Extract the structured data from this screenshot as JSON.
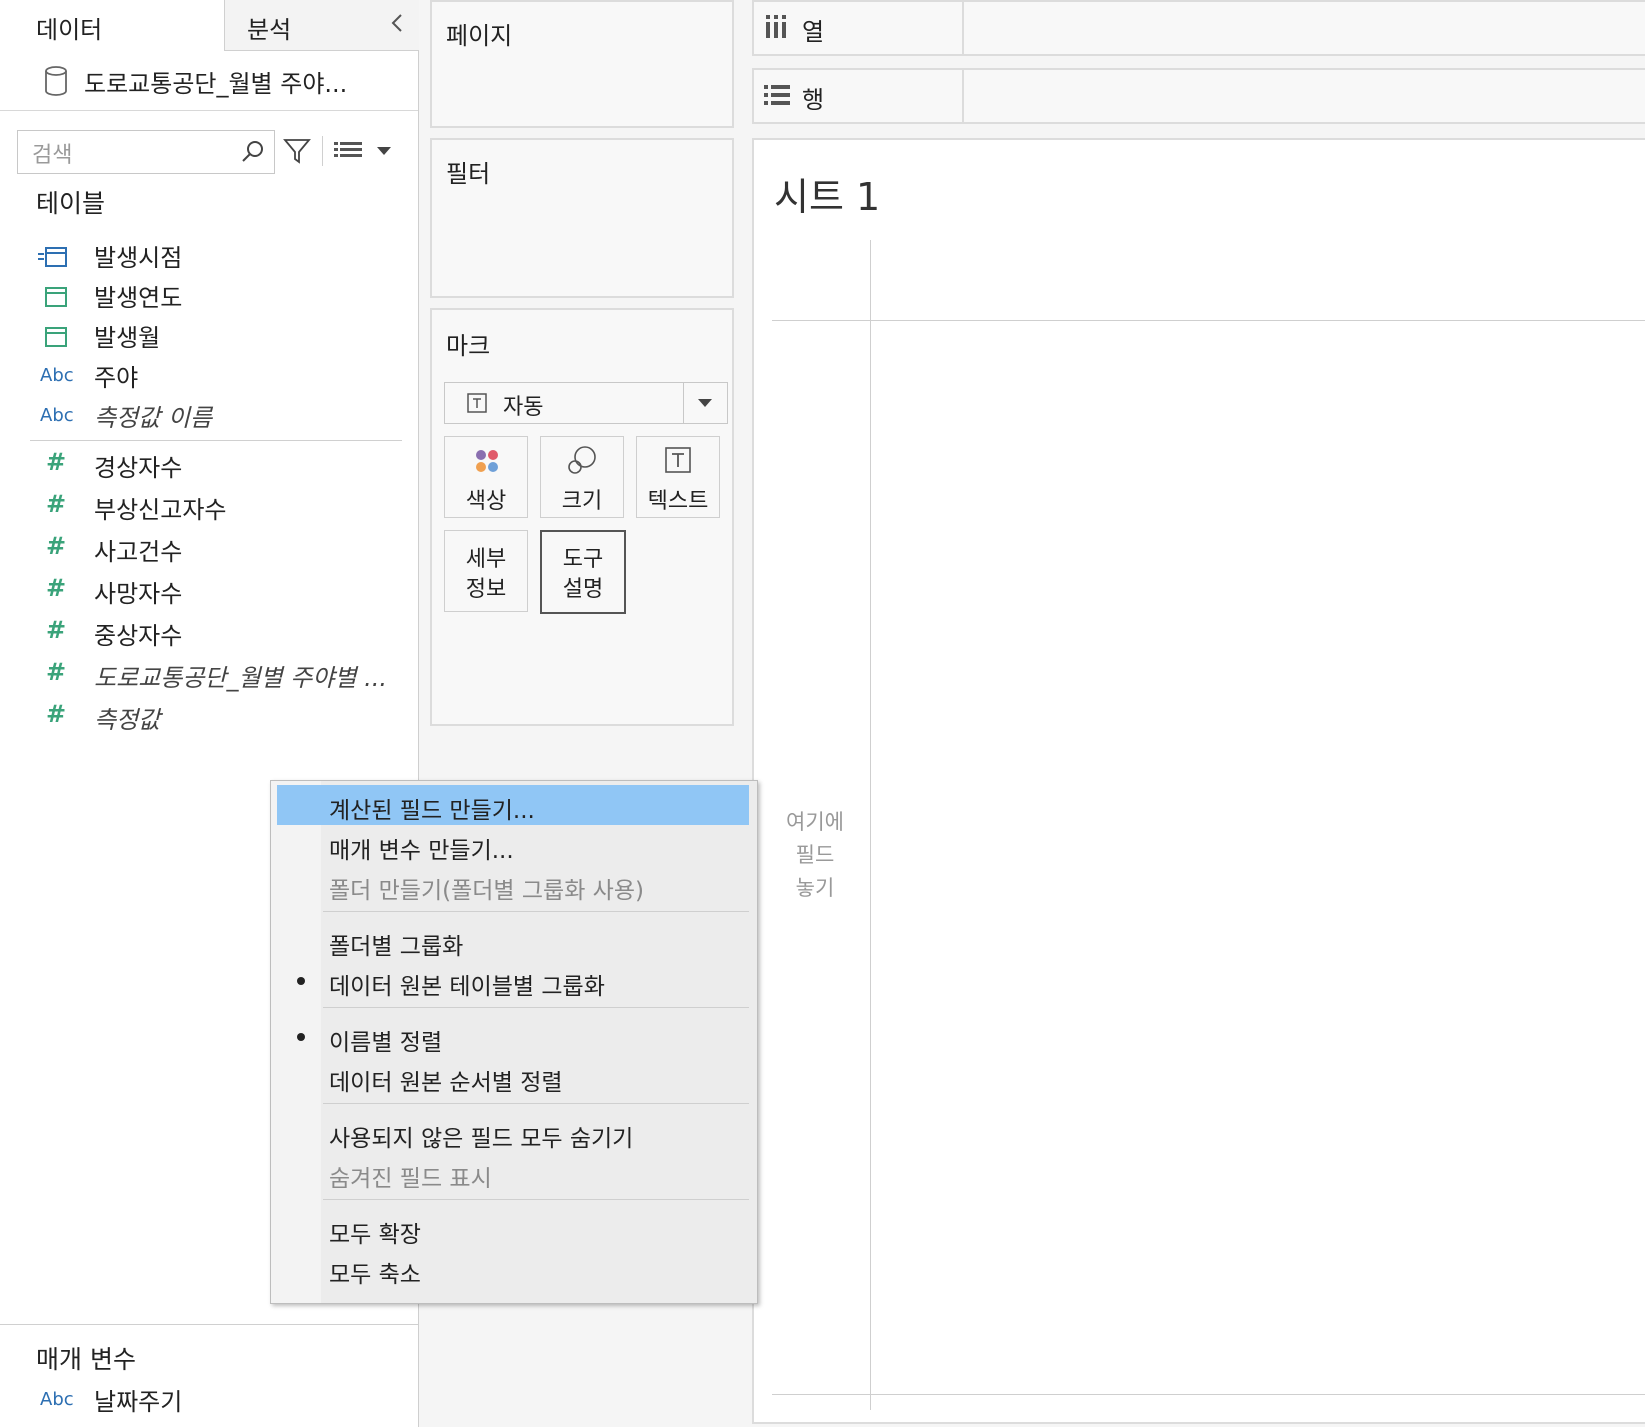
{
  "tabs": {
    "data": "데이터",
    "analysis": "분석"
  },
  "datasource": {
    "name": "도로교통공단_월별 주야..."
  },
  "search": {
    "placeholder": "검색"
  },
  "tables_section": {
    "title": "테이블",
    "dimensions": [
      {
        "icon": "datetime-icon",
        "label": "발생시점",
        "italic": false
      },
      {
        "icon": "date-icon",
        "label": "발생연도",
        "italic": false
      },
      {
        "icon": "date-icon",
        "label": "발생월",
        "italic": false
      },
      {
        "icon": "string-icon",
        "icon_text": "Abc",
        "label": "주야",
        "italic": false
      },
      {
        "icon": "string-icon",
        "icon_text": "Abc",
        "label": "측정값 이름",
        "italic": true
      }
    ],
    "measures": [
      {
        "icon": "number-icon",
        "icon_text": "#",
        "label": "경상자수",
        "italic": false
      },
      {
        "icon": "number-icon",
        "icon_text": "#",
        "label": "부상신고자수",
        "italic": false
      },
      {
        "icon": "number-icon",
        "icon_text": "#",
        "label": "사고건수",
        "italic": false
      },
      {
        "icon": "number-icon",
        "icon_text": "#",
        "label": "사망자수",
        "italic": false
      },
      {
        "icon": "number-icon",
        "icon_text": "#",
        "label": "중상자수",
        "italic": false
      },
      {
        "icon": "number-icon",
        "icon_text": "#",
        "label": "도로교통공단_월별 주야별 ...",
        "italic": true
      },
      {
        "icon": "number-icon",
        "icon_text": "#",
        "label": "측정값",
        "italic": true
      }
    ]
  },
  "params_section": {
    "title": "매개 변수",
    "items": [
      {
        "icon": "string-icon",
        "icon_text": "Abc",
        "label": "날짜주기"
      }
    ]
  },
  "cards": {
    "pages": "페이지",
    "filters": "필터",
    "marks": "마크"
  },
  "marks": {
    "type": "자동",
    "buttons": [
      {
        "name": "color",
        "label": "색상"
      },
      {
        "name": "size",
        "label": "크기"
      },
      {
        "name": "text",
        "label": "텍스트"
      },
      {
        "name": "detail",
        "label": "세부\n정보"
      },
      {
        "name": "tooltip",
        "label": "도구\n설명"
      }
    ]
  },
  "shelves": {
    "columns": "열",
    "rows": "행"
  },
  "sheet": {
    "title": "시트 1",
    "drop_hint": "여기에\n필드\n놓기"
  },
  "context_menu": {
    "items": [
      {
        "label": "계산된 필드 만들기...",
        "highlighted": true
      },
      {
        "label": "매개 변수 만들기..."
      },
      {
        "label": "폴더 만들기(폴더별 그룹화 사용)",
        "disabled": true
      },
      {
        "label": "폴더별 그룹화"
      },
      {
        "label": "데이터 원본 테이블별 그룹화",
        "checked": true
      },
      {
        "label": "이름별 정렬",
        "checked": true
      },
      {
        "label": "데이터 원본 순서별 정렬"
      },
      {
        "label": "사용되지 않은 필드 모두 숨기기"
      },
      {
        "label": "숨겨진 필드 표시",
        "disabled": true
      },
      {
        "label": "모두 확장"
      },
      {
        "label": "모두 축소"
      }
    ]
  },
  "colors": {
    "highlight": "#90c6f5",
    "measure_green": "#3aa37a",
    "dimension_blue": "#2d6fb2"
  }
}
